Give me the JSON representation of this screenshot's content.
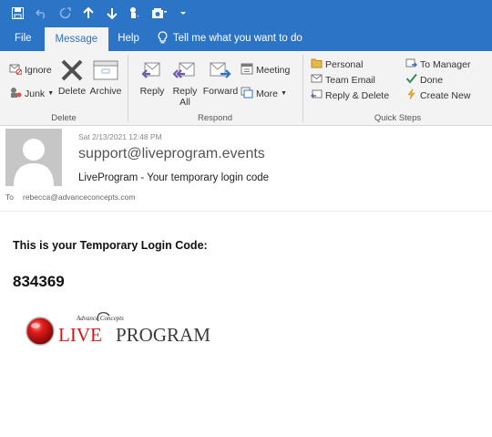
{
  "ribbon_tabs": {
    "file": "File",
    "message": "Message",
    "help": "Help",
    "tell_me": "Tell me what you want to do"
  },
  "delete_group": {
    "ignore": "Ignore",
    "junk": "Junk",
    "delete": "Delete",
    "archive": "Archive",
    "label": "Delete"
  },
  "respond_group": {
    "reply": "Reply",
    "reply_all_line1": "Reply",
    "reply_all_line2": "All",
    "forward": "Forward",
    "meeting": "Meeting",
    "more": "More",
    "label": "Respond"
  },
  "quick_steps": {
    "items": [
      "Personal",
      "Team Email",
      "Reply & Delete",
      "To Manager",
      "Done",
      "Create New"
    ],
    "label": "Quick Steps"
  },
  "email": {
    "date": "Sat 2/13/2021 12:48 PM",
    "sender": "support@liveprogram.events",
    "subject": "LiveProgram - Your temporary login code",
    "to_label": "To",
    "to_address": "rebecca@advanceconcepts.com",
    "body_title": "This is your Temporary Login Code:",
    "code": "834369"
  },
  "logo": {
    "tagline": "Advance Concepts",
    "live": "LIVE",
    "program": "PROGRAM"
  },
  "colors": {
    "accent": "#2b74c6",
    "ribbon_bg": "#f3f3f3",
    "logo_red": "#d21a1a"
  }
}
